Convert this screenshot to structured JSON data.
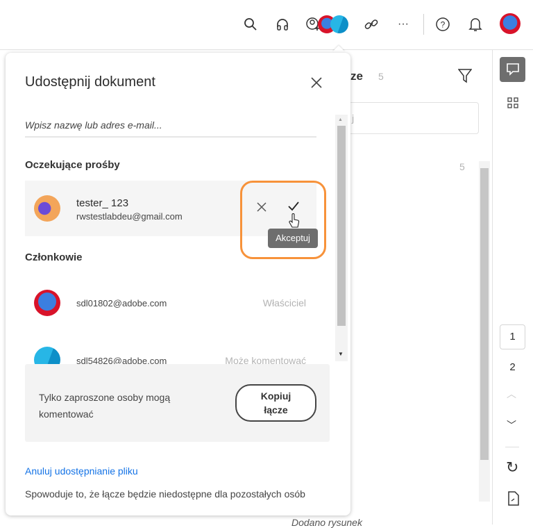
{
  "topbar": {
    "icons": [
      "search-icon",
      "headphones-icon",
      "add-person-icon",
      "link-icon",
      "more-icon",
      "help-icon",
      "bell-icon"
    ]
  },
  "panel": {
    "title_fragment": "ze",
    "count": "5",
    "search_fragment": "j",
    "group_count": "5",
    "bottom_fragment": "Dodano rysunek"
  },
  "rail": {
    "page1": "1",
    "page2": "2"
  },
  "dialog": {
    "title": "Udostępnij dokument",
    "input_placeholder": "Wpisz nazwę lub adres e-mail...",
    "pending_heading": "Oczekujące prośby",
    "pending": [
      {
        "name": "tester_ 123",
        "email": "rwstestlabdeu@gmail.com"
      }
    ],
    "accept_tooltip": "Akceptuj",
    "members_heading": "Członkowie",
    "members": [
      {
        "email": "sdl01802@adobe.com",
        "role": "Właściciel"
      },
      {
        "email": "sdl54826@adobe.com",
        "role": "Może komentować"
      }
    ],
    "info_text": "Tylko zaproszone osoby mogą komentować",
    "copy_button": "Kopiuj łącze",
    "unshare_link": "Anuluj udostępnianie pliku",
    "unshare_desc": "Spowoduje to, że łącze będzie niedostępne dla pozostałych osób"
  },
  "colors": {
    "highlight": "#f7923a",
    "link": "#1473e6"
  }
}
